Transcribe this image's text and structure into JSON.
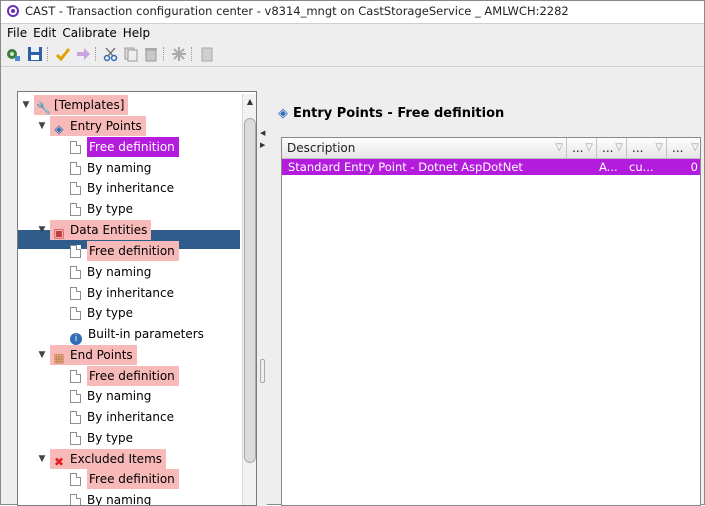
{
  "window": {
    "title": "CAST - Transaction configuration center - v8314_mngt on CastStorageService _ AMLWCH:2282"
  },
  "menu": [
    "File",
    "Edit",
    "Calibrate",
    "Help"
  ],
  "toolbar": {
    "icons": [
      "run-icon",
      "save-icon",
      "check-icon",
      "forward-icon",
      "cut-icon",
      "copy-icon",
      "delete-icon",
      "asterisk-icon",
      "paste-icon"
    ]
  },
  "tree": {
    "root": "[Templates]",
    "entry_points": {
      "label": "Entry Points",
      "items": [
        "Free definition",
        "By naming",
        "By inheritance",
        "By type"
      ]
    },
    "data_entities": {
      "label": "Data Entities",
      "items": [
        "Free definition",
        "By naming",
        "By inheritance",
        "By type",
        "Built-in parameters"
      ]
    },
    "end_points": {
      "label": "End Points",
      "items": [
        "Free definition",
        "By naming",
        "By inheritance",
        "By type"
      ]
    },
    "excluded_items": {
      "label": "Excluded Items",
      "items": [
        "Free definition",
        "By naming"
      ]
    }
  },
  "panel": {
    "title": "Entry Points - Free definition",
    "columns": [
      "Description",
      "...",
      "...",
      "...",
      "..."
    ],
    "rows": [
      {
        "description": "Standard Entry Point - Dotnet AspDotNet",
        "c1": "A...",
        "c2": "cu...",
        "c3": "",
        "c4": "0"
      }
    ]
  }
}
